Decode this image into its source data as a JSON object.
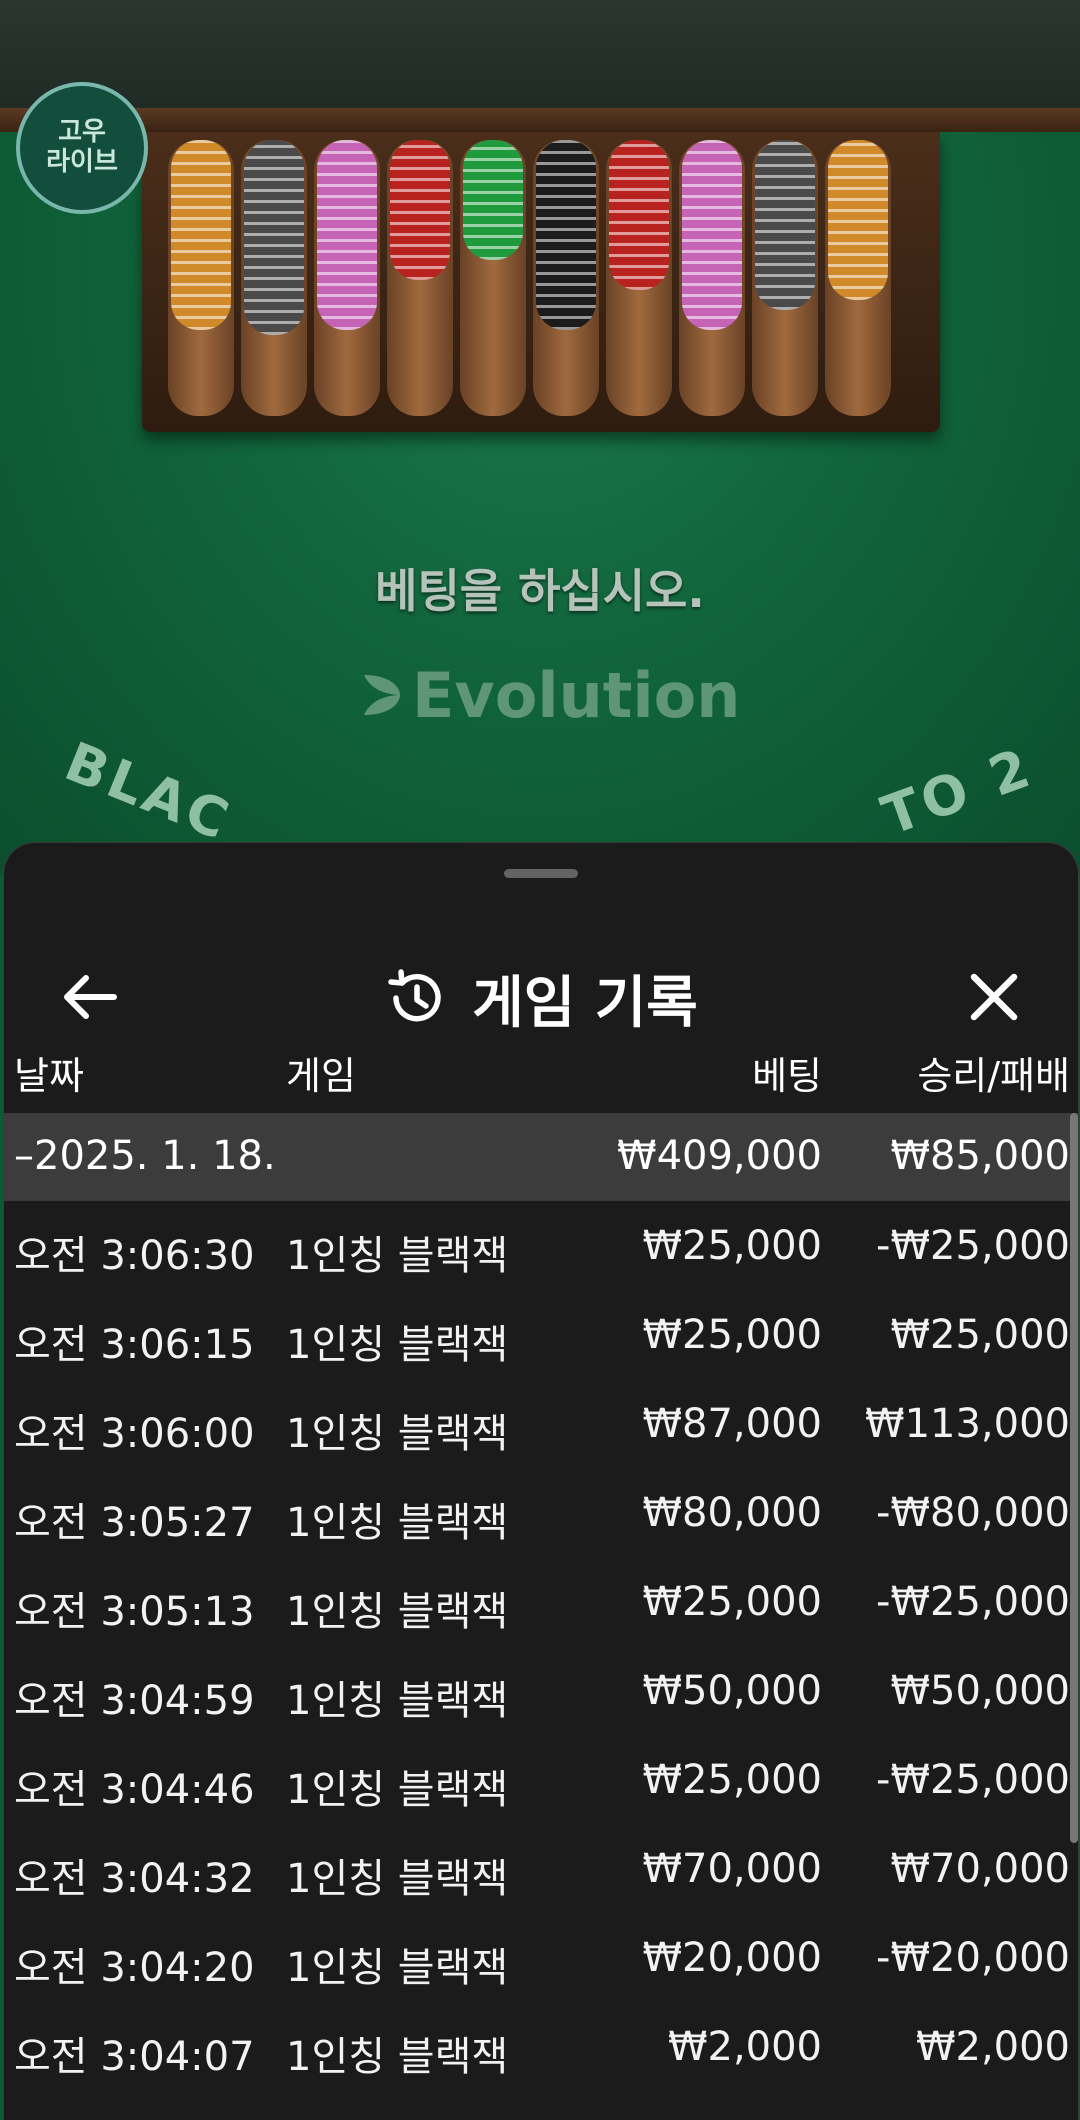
{
  "game_view": {
    "logo_line1": "고우",
    "logo_line2": "라이브",
    "prompt": "베팅을 하십시오.",
    "provider": "Evolution",
    "table_text_left": "BLAC",
    "table_text_right": "TO 2",
    "chip_colors": [
      "#d08a2a",
      "#4a4a4a",
      "#c564b4",
      "#b8231f",
      "#1f9a3c",
      "#1c1c1c",
      "#b8231f",
      "#c564b4",
      "#4a4a4a",
      "#d08a2a"
    ]
  },
  "history": {
    "title": "게임 기록",
    "back_icon": "arrow-left-icon",
    "history_icon": "history-icon",
    "close_icon": "close-icon",
    "columns": {
      "date": "날짜",
      "game": "게임",
      "bet": "베팅",
      "win_loss": "승리/패배"
    },
    "date_group": {
      "label": "–2025. 1. 18.",
      "bet": "₩409,000",
      "win_loss": "₩85,000"
    },
    "rows": [
      {
        "time": "오전 3:06:30",
        "game": "1인칭 블랙잭",
        "bet": "₩25,000",
        "win_loss": "-₩25,000"
      },
      {
        "time": "오전 3:06:15",
        "game": "1인칭 블랙잭",
        "bet": "₩25,000",
        "win_loss": "₩25,000"
      },
      {
        "time": "오전 3:06:00",
        "game": "1인칭 블랙잭",
        "bet": "₩87,000",
        "win_loss": "₩113,000"
      },
      {
        "time": "오전 3:05:27",
        "game": "1인칭 블랙잭",
        "bet": "₩80,000",
        "win_loss": "-₩80,000"
      },
      {
        "time": "오전 3:05:13",
        "game": "1인칭 블랙잭",
        "bet": "₩25,000",
        "win_loss": "-₩25,000"
      },
      {
        "time": "오전 3:04:59",
        "game": "1인칭 블랙잭",
        "bet": "₩50,000",
        "win_loss": "₩50,000"
      },
      {
        "time": "오전 3:04:46",
        "game": "1인칭 블랙잭",
        "bet": "₩25,000",
        "win_loss": "-₩25,000"
      },
      {
        "time": "오전 3:04:32",
        "game": "1인칭 블랙잭",
        "bet": "₩70,000",
        "win_loss": "₩70,000"
      },
      {
        "time": "오전 3:04:20",
        "game": "1인칭 블랙잭",
        "bet": "₩20,000",
        "win_loss": "-₩20,000"
      },
      {
        "time": "오전 3:04:07",
        "game": "1인칭 블랙잭",
        "bet": "₩2,000",
        "win_loss": "₩2,000"
      }
    ]
  }
}
